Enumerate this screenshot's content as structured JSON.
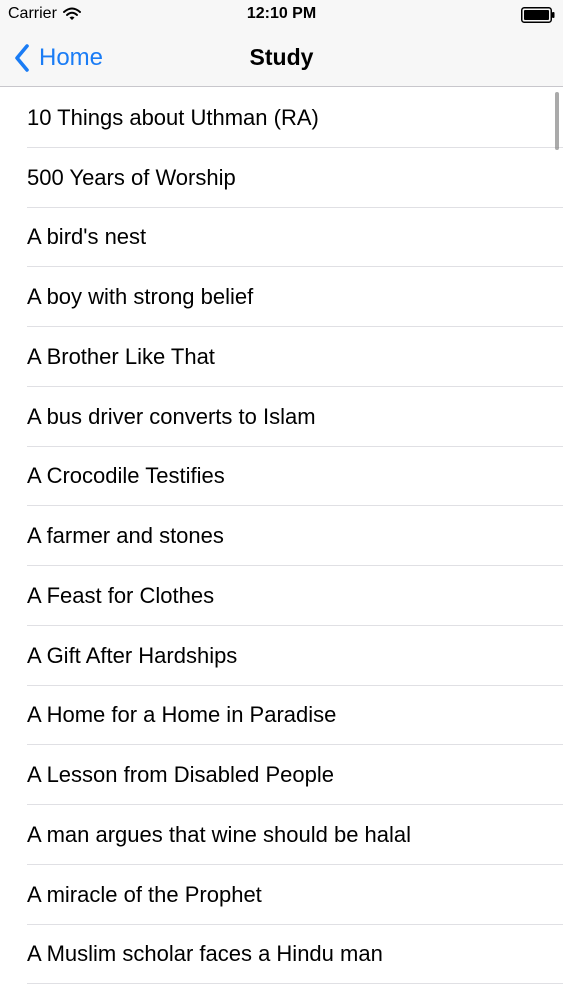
{
  "status_bar": {
    "carrier": "Carrier",
    "time": "12:10 PM",
    "wifi_icon": "wifi-icon",
    "battery_icon": "battery-icon"
  },
  "nav": {
    "back_label": "Home",
    "back_icon": "chevron-left-icon",
    "title": "Study"
  },
  "colors": {
    "accent": "#1a7cf5",
    "bar_background": "#f7f7f7",
    "separator": "#e0e0e4"
  },
  "items": [
    {
      "label": "10 Things about Uthman (RA)"
    },
    {
      "label": "500 Years of Worship"
    },
    {
      "label": "A bird's nest"
    },
    {
      "label": "A boy with strong belief"
    },
    {
      "label": "A Brother Like That"
    },
    {
      "label": "A bus driver converts to Islam"
    },
    {
      "label": "A Crocodile Testifies"
    },
    {
      "label": "A farmer and stones"
    },
    {
      "label": "A Feast for Clothes"
    },
    {
      "label": "A Gift After Hardships"
    },
    {
      "label": "A Home for a Home in Paradise"
    },
    {
      "label": "A Lesson from Disabled People"
    },
    {
      "label": "A man argues that wine should be halal"
    },
    {
      "label": "A miracle of the Prophet"
    },
    {
      "label": "A Muslim scholar faces a Hindu man"
    }
  ]
}
